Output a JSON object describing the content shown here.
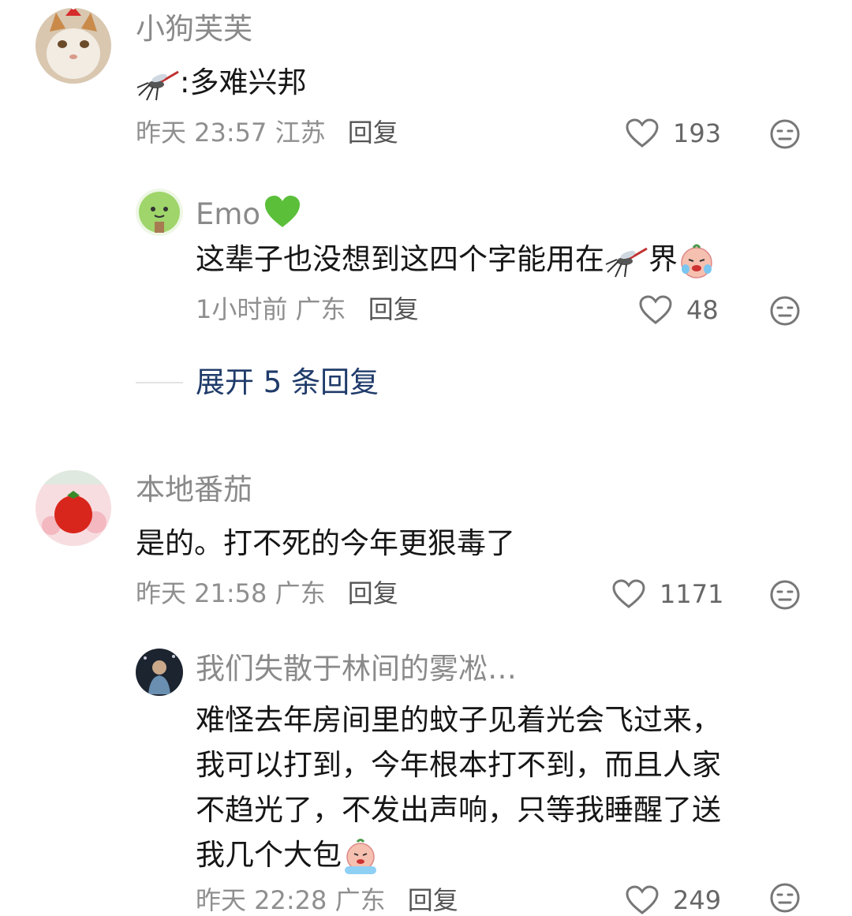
{
  "comments": [
    {
      "author": "小狗芙芙",
      "text_suffix": ":多难兴邦",
      "time": "昨天 23:57",
      "location": "江苏",
      "reply_label": "回复",
      "likes": "193",
      "replies": [
        {
          "author": "Emo",
          "text_prefix": "这辈子也没想到这四个字能用在",
          "text_suffix": "界",
          "time": "1小时前",
          "location": "广东",
          "reply_label": "回复",
          "likes": "48"
        }
      ],
      "expand_label": "展开 5 条回复"
    },
    {
      "author": "本地番茄",
      "text": "是的。打不死的今年更狠毒了",
      "time": "昨天 21:58",
      "location": "广东",
      "reply_label": "回复",
      "likes": "1171",
      "replies": [
        {
          "author": "我们失散于林间的雾凇…",
          "lines": [
            "难怪去年房间里的蚊子见着光会飞过来，",
            "我可以打到，今年根本打不到，而且人家",
            "不趋光了，不发出声响，只等我睡醒了送",
            "我几个大包"
          ],
          "time": "昨天 22:28",
          "location": "广东",
          "reply_label": "回复",
          "likes": "249"
        }
      ]
    }
  ],
  "icons": {
    "like": "heart-outline-icon",
    "dislike": "meh-face-icon",
    "mosquito": "mosquito-emoji",
    "crying": "crying-face-emoji",
    "green_heart": "green-heart-emoji"
  },
  "colors": {
    "name": "#8a8a8a",
    "meta": "#8f8f8f",
    "expand": "#1f3b6a",
    "green_heart": "#5bbf3a"
  }
}
